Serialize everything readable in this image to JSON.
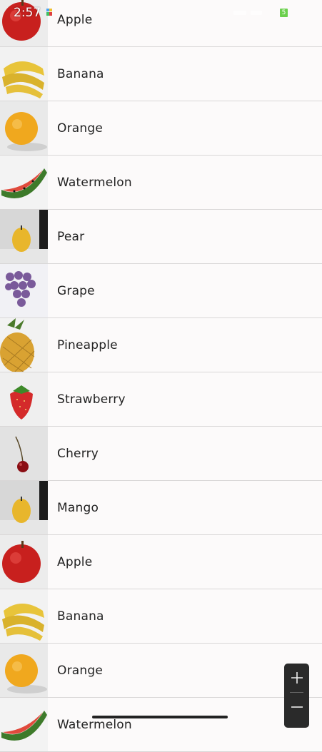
{
  "status_bar": {
    "time": "2:57",
    "battery_level": "5"
  },
  "fruits": [
    {
      "name": "Apple",
      "icon": "apple-image"
    },
    {
      "name": "Banana",
      "icon": "banana-image"
    },
    {
      "name": "Orange",
      "icon": "orange-image"
    },
    {
      "name": "Watermelon",
      "icon": "watermelon-image"
    },
    {
      "name": "Pear",
      "icon": "pear-image"
    },
    {
      "name": "Grape",
      "icon": "grape-image"
    },
    {
      "name": "Pineapple",
      "icon": "pineapple-image"
    },
    {
      "name": "Strawberry",
      "icon": "strawberry-image"
    },
    {
      "name": "Cherry",
      "icon": "cherry-image"
    },
    {
      "name": "Mango",
      "icon": "mango-image"
    },
    {
      "name": "Apple",
      "icon": "apple-image"
    },
    {
      "name": "Banana",
      "icon": "banana-image"
    },
    {
      "name": "Orange",
      "icon": "orange-image"
    },
    {
      "name": "Watermelon",
      "icon": "watermelon-image"
    }
  ],
  "zoom_controls": {
    "zoom_in_icon": "plus-icon",
    "zoom_out_icon": "minus-icon"
  },
  "colors": {
    "background": "#fcfafa",
    "divider": "#d9d7d7",
    "zoom_panel": "#2a2a2a",
    "battery": "#6bd04d"
  }
}
